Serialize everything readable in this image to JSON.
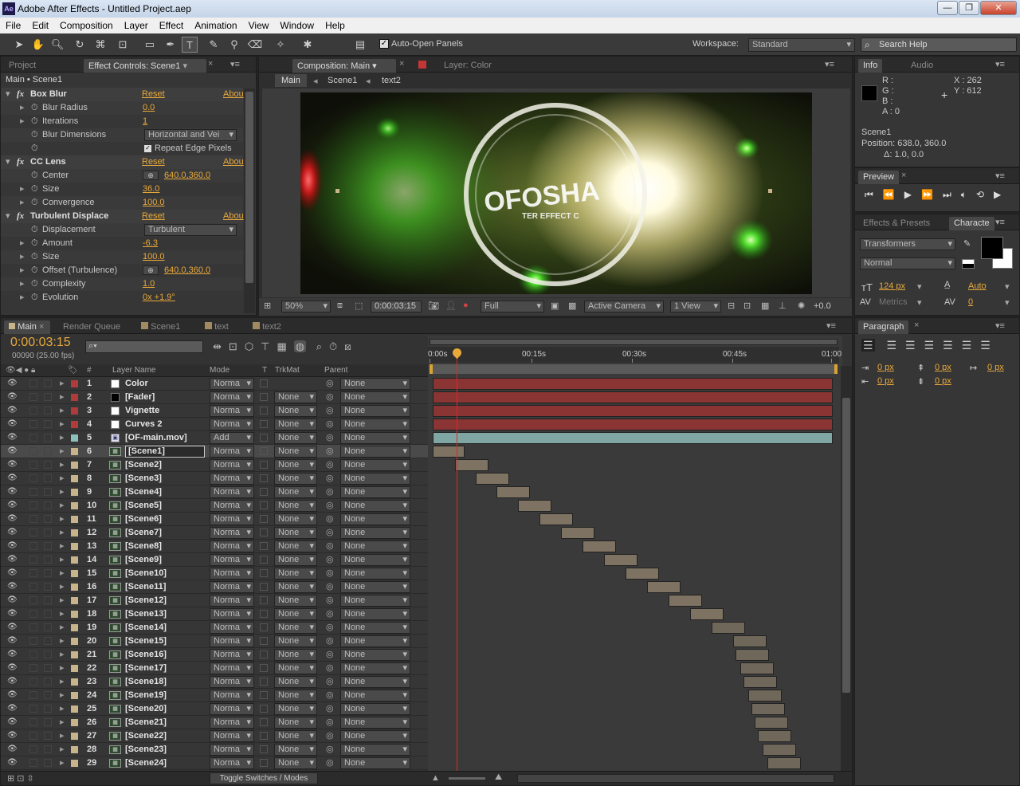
{
  "window": {
    "title": "Adobe After Effects - Untitled Project.aep",
    "minimize": "—",
    "restore": "❐",
    "close": "✕",
    "app_icon": "Ae"
  },
  "menu": [
    "File",
    "Edit",
    "Composition",
    "Layer",
    "Effect",
    "Animation",
    "View",
    "Window",
    "Help"
  ],
  "toolbar": {
    "auto_open": "Auto-Open Panels",
    "workspace_label": "Workspace:",
    "workspace_value": "Standard",
    "search_placeholder": "Search Help"
  },
  "project_panel": {
    "tab_project": "Project",
    "tab_effects": "Effect Controls: Scene1",
    "breadcrumb": "Main • Scene1"
  },
  "effects": [
    {
      "name": "Box Blur",
      "reset": "Reset",
      "about": "Abou",
      "props": [
        {
          "label": "Blur Radius",
          "value": "0.0"
        },
        {
          "label": "Iterations",
          "value": "1"
        },
        {
          "label": "Blur Dimensions",
          "dropdown": "Horizontal and Vei"
        },
        {
          "label": "",
          "checkbox": "Repeat Edge Pixels"
        }
      ]
    },
    {
      "name": "CC Lens",
      "reset": "Reset",
      "about": "Abou",
      "props": [
        {
          "label": "Center",
          "value": "640.0,360.0"
        },
        {
          "label": "Size",
          "value": "36.0"
        },
        {
          "label": "Convergence",
          "value": "100.0"
        }
      ]
    },
    {
      "name": "Turbulent Displace",
      "reset": "Reset",
      "about": "Abou",
      "props": [
        {
          "label": "Displacement",
          "dropdown": "Turbulent"
        },
        {
          "label": "Amount",
          "value": "-6.3"
        },
        {
          "label": "Size",
          "value": "100.0"
        },
        {
          "label": "Offset (Turbulence)",
          "value": "640.0,360.0"
        },
        {
          "label": "Complexity",
          "value": "1.0"
        },
        {
          "label": "Evolution",
          "value": "0x +1.9°"
        }
      ]
    }
  ],
  "comp_panel": {
    "tab_comp": "Composition: Main",
    "tab_layer": "Layer: Color",
    "crumbs": [
      "Main",
      "Scene1",
      "text2"
    ],
    "zoom": "50%",
    "timecode": "0:00:03:15",
    "resolution": "Full",
    "camera": "Active Camera",
    "views": "1 View",
    "exposure": "+0.0"
  },
  "info_panel": {
    "tab_info": "Info",
    "tab_audio": "Audio",
    "r": "R :",
    "g": "G :",
    "b": "B :",
    "a": "A : 0",
    "x": "X : 262",
    "y": "Y : 612",
    "layer": "Scene1",
    "position": "Position: 638.0, 360.0",
    "delta": "Δ: 1.0, 0.0"
  },
  "preview_panel": {
    "tab": "Preview"
  },
  "character_panel": {
    "tab_effects": "Effects & Presets",
    "tab_char": "Characte",
    "font": "Transformers",
    "style": "Normal",
    "size": "124 px",
    "leading": "Auto",
    "kerning": "Metrics",
    "tracking": "0"
  },
  "paragraph_panel": {
    "tab": "Paragraph",
    "v1": "0 px",
    "v2": "0 px",
    "v3": "0 px",
    "v4": "0 px",
    "v5": "0 px"
  },
  "timeline": {
    "tabs": [
      "Main",
      "Render Queue",
      "Scene1",
      "text",
      "text2"
    ],
    "timecode": "0:00:03:15",
    "frames": "00090 (25.00 fps)",
    "col_hash": "#",
    "col_name": "Layer Name",
    "col_mode": "Mode",
    "col_t": "T",
    "col_trkmat": "TrkMat",
    "col_parent": "Parent",
    "ruler": [
      "0:00s",
      "00:15s",
      "00:30s",
      "00:45s",
      "01:00"
    ],
    "toggle": "Toggle Switches / Modes",
    "layers": [
      {
        "n": "1",
        "name": "Color",
        "mode": "Norma",
        "trk": "",
        "parent": "None",
        "color": "#b03b3b",
        "icon": "solid-white"
      },
      {
        "n": "2",
        "name": "[Fader]",
        "mode": "Norma",
        "trk": "None",
        "parent": "None",
        "color": "#b03b3b",
        "icon": "solid-black"
      },
      {
        "n": "3",
        "name": "Vignette",
        "mode": "Norma",
        "trk": "None",
        "parent": "None",
        "color": "#b03b3b",
        "icon": "solid-white"
      },
      {
        "n": "4",
        "name": "Curves 2",
        "mode": "Norma",
        "trk": "None",
        "parent": "None",
        "color": "#b03b3b",
        "icon": "solid-white"
      },
      {
        "n": "5",
        "name": "[OF-main.mov]",
        "mode": "Add",
        "trk": "None",
        "parent": "None",
        "color": "#8ec0bb",
        "icon": "footage"
      },
      {
        "n": "6",
        "name": "[Scene1]",
        "mode": "Norma",
        "trk": "None",
        "parent": "None",
        "color": "#c8b48a",
        "icon": "comp"
      },
      {
        "n": "7",
        "name": "[Scene2]",
        "mode": "Norma",
        "trk": "None",
        "parent": "None",
        "color": "#c8b48a",
        "icon": "comp"
      },
      {
        "n": "8",
        "name": "[Scene3]",
        "mode": "Norma",
        "trk": "None",
        "parent": "None",
        "color": "#c8b48a",
        "icon": "comp"
      },
      {
        "n": "9",
        "name": "[Scene4]",
        "mode": "Norma",
        "trk": "None",
        "parent": "None",
        "color": "#c8b48a",
        "icon": "comp"
      },
      {
        "n": "10",
        "name": "[Scene5]",
        "mode": "Norma",
        "trk": "None",
        "parent": "None",
        "color": "#c8b48a",
        "icon": "comp"
      },
      {
        "n": "11",
        "name": "[Scene6]",
        "mode": "Norma",
        "trk": "None",
        "parent": "None",
        "color": "#c8b48a",
        "icon": "comp"
      },
      {
        "n": "12",
        "name": "[Scene7]",
        "mode": "Norma",
        "trk": "None",
        "parent": "None",
        "color": "#c8b48a",
        "icon": "comp"
      },
      {
        "n": "13",
        "name": "[Scene8]",
        "mode": "Norma",
        "trk": "None",
        "parent": "None",
        "color": "#c8b48a",
        "icon": "comp"
      },
      {
        "n": "14",
        "name": "[Scene9]",
        "mode": "Norma",
        "trk": "None",
        "parent": "None",
        "color": "#c8b48a",
        "icon": "comp"
      },
      {
        "n": "15",
        "name": "[Scene10]",
        "mode": "Norma",
        "trk": "None",
        "parent": "None",
        "color": "#c8b48a",
        "icon": "comp"
      },
      {
        "n": "16",
        "name": "[Scene11]",
        "mode": "Norma",
        "trk": "None",
        "parent": "None",
        "color": "#c8b48a",
        "icon": "comp"
      },
      {
        "n": "17",
        "name": "[Scene12]",
        "mode": "Norma",
        "trk": "None",
        "parent": "None",
        "color": "#c8b48a",
        "icon": "comp"
      },
      {
        "n": "18",
        "name": "[Scene13]",
        "mode": "Norma",
        "trk": "None",
        "parent": "None",
        "color": "#c8b48a",
        "icon": "comp"
      },
      {
        "n": "19",
        "name": "[Scene14]",
        "mode": "Norma",
        "trk": "None",
        "parent": "None",
        "color": "#c8b48a",
        "icon": "comp"
      },
      {
        "n": "20",
        "name": "[Scene15]",
        "mode": "Norma",
        "trk": "None",
        "parent": "None",
        "color": "#c8b48a",
        "icon": "comp"
      },
      {
        "n": "21",
        "name": "[Scene16]",
        "mode": "Norma",
        "trk": "None",
        "parent": "None",
        "color": "#c8b48a",
        "icon": "comp"
      },
      {
        "n": "22",
        "name": "[Scene17]",
        "mode": "Norma",
        "trk": "None",
        "parent": "None",
        "color": "#c8b48a",
        "icon": "comp"
      },
      {
        "n": "23",
        "name": "[Scene18]",
        "mode": "Norma",
        "trk": "None",
        "parent": "None",
        "color": "#c8b48a",
        "icon": "comp"
      },
      {
        "n": "24",
        "name": "[Scene19]",
        "mode": "Norma",
        "trk": "None",
        "parent": "None",
        "color": "#c8b48a",
        "icon": "comp"
      },
      {
        "n": "25",
        "name": "[Scene20]",
        "mode": "Norma",
        "trk": "None",
        "parent": "None",
        "color": "#c8b48a",
        "icon": "comp"
      },
      {
        "n": "26",
        "name": "[Scene21]",
        "mode": "Norma",
        "trk": "None",
        "parent": "None",
        "color": "#c8b48a",
        "icon": "comp"
      },
      {
        "n": "27",
        "name": "[Scene22]",
        "mode": "Norma",
        "trk": "None",
        "parent": "None",
        "color": "#c8b48a",
        "icon": "comp"
      },
      {
        "n": "28",
        "name": "[Scene23]",
        "mode": "Norma",
        "trk": "None",
        "parent": "None",
        "color": "#c8b48a",
        "icon": "comp"
      },
      {
        "n": "29",
        "name": "[Scene24]",
        "mode": "Norma",
        "trk": "None",
        "parent": "None",
        "color": "#c8b48a",
        "icon": "comp"
      }
    ]
  },
  "colors": {
    "accent": "#e9a93a",
    "playhead": "#d62a2a",
    "panel": "#363636"
  }
}
